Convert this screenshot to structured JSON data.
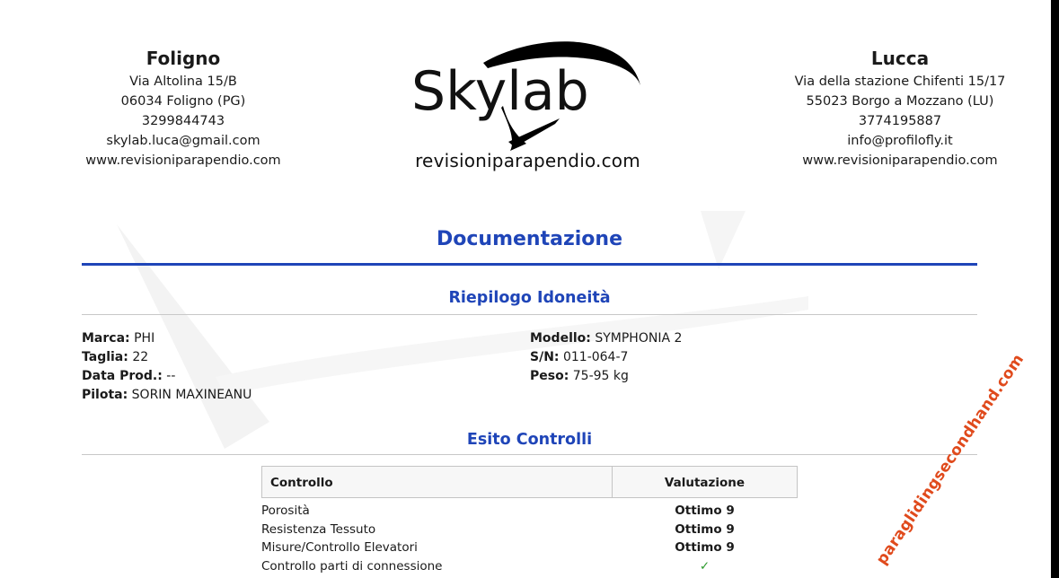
{
  "left_office": {
    "city": "Foligno",
    "lines": [
      "Via Altolina 15/B",
      "06034 Foligno (PG)",
      "3299844743",
      "skylab.luca@gmail.com",
      "www.revisioniparapendio.com"
    ]
  },
  "logo": {
    "brand": "Skylab",
    "site": "revisioniparapendio.com"
  },
  "right_office": {
    "city": "Lucca",
    "lines": [
      "Via della stazione Chifenti 15/17",
      "55023 Borgo a Mozzano (LU)",
      "3774195887",
      "info@profilofly.it",
      "www.revisioniparapendio.com"
    ]
  },
  "document": {
    "title": "Documentazione",
    "summary_title": "Riepilogo Idoneità",
    "checks_title": "Esito Controlli"
  },
  "fields_left": [
    {
      "label": "Marca:",
      "value": "PHI"
    },
    {
      "label": "Taglia:",
      "value": "22"
    },
    {
      "label": "Data Prod.:",
      "value": "--"
    },
    {
      "label": "Pilota:",
      "value": "SORIN MAXINEANU"
    }
  ],
  "fields_right": [
    {
      "label": "Modello:",
      "value": "SYMPHONIA 2"
    },
    {
      "label": "S/N:",
      "value": "011-064-7"
    },
    {
      "label": "Peso:",
      "value": "75-95 kg"
    }
  ],
  "table": {
    "headers": [
      "Controllo",
      "Valutazione"
    ],
    "rows": [
      {
        "control": "Porosità",
        "rating": "Ottimo 9"
      },
      {
        "control": "Resistenza Tessuto",
        "rating": "Ottimo 9"
      },
      {
        "control": "Misure/Controllo Elevatori",
        "rating": "Ottimo 9"
      },
      {
        "control": "Controllo parti di connessione",
        "rating": "✓"
      }
    ]
  },
  "watermark": "paraglidingsecondhand.com",
  "colors": {
    "accent": "#1f45b8",
    "check": "#2e9a2e",
    "watermark": "#e04a1c"
  }
}
